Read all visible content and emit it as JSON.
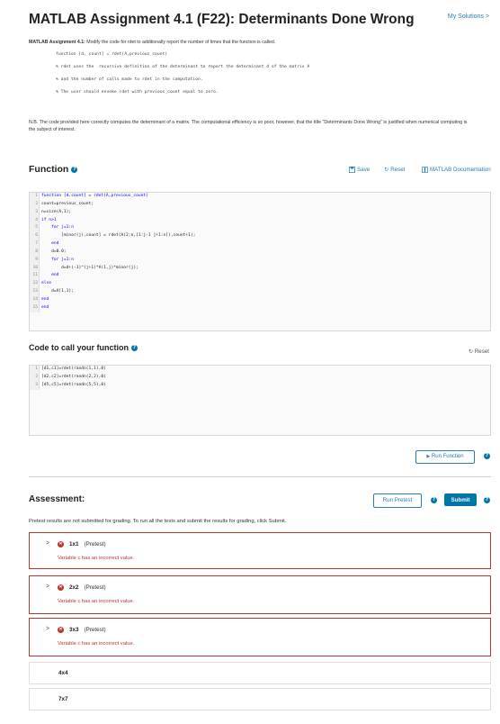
{
  "header": {
    "title": "MATLAB Assignment 4.1 (F22): Determinants Done Wrong",
    "my_solutions": "My Solutions >"
  },
  "intro": {
    "label": "MATLAB Assignment 4.1:",
    "text": "Modify the code for rdet to additionally report the number of times that the function is called.",
    "code_lines": [
      "function [d, count] = rdet(A,previous_count)",
      "% rdet uses the  recursive definition of the determinant to report the determinant d of the matrix A",
      "% and the number of calls made to rdet in the computation.",
      "% The user should envoke rdet with previous_count equal to zero."
    ]
  },
  "nb_text": "N.B. The code provided here correctly computes the determinant of a matrix.  The computational efficiency is so poor, however, that the title \"Determinants Done Wrong\" is justified when numerical computing is the subject of interest.",
  "function_section": {
    "heading": "Function",
    "help_glyph": "?",
    "save": "Save",
    "reset": "Reset",
    "doc": "MATLAB Documentation",
    "code": [
      "function [d,count] = rdet(A,previous_count)",
      "count=previous_count;",
      "n=size(A,1);",
      "if n>1",
      "    for j=1:n",
      "        [minor(j),count] = rdet(A(2:n,[1:j-1 j+1:n]),count+1);",
      "    end",
      "    d=0.0;",
      "    for j=1:n",
      "        d=d+(-1)^(j+1)*A(1,j)*minor(j);",
      "    end",
      "else",
      "    d=A(1,1);",
      "end",
      "end"
    ]
  },
  "call_section": {
    "heading": "Code to call your function",
    "reset": "Reset",
    "code": [
      "[d1,c1]=rdet(randn(1,1),0)",
      "[d2,c2]=rdet(randn(2,2),0)",
      "[d5,c5]=rdet(randn(5,5),0)"
    ],
    "run_button": "Run Function"
  },
  "assessment": {
    "heading": "Assessment:",
    "run_pretest": "Run Pretest",
    "submit": "Submit",
    "note": "Pretest results are not submitted for grading. To run all the tests and submit the results for grading, click Submit.",
    "tests": [
      {
        "name": "1x1",
        "mode": "(Pretest)",
        "message": "Variable c has an incorrect value."
      },
      {
        "name": "2x2",
        "mode": "(Pretest)",
        "message": "Variable c has an incorrect value."
      },
      {
        "name": "3x3",
        "mode": "(Pretest)",
        "message": "Variable c has an incorrect value."
      }
    ],
    "pending": [
      "4x4",
      "7x7"
    ]
  },
  "colors": {
    "accent": "#0076a8",
    "link": "#2a7bb7",
    "fail": "#c0342c",
    "keyword": "#0000ff",
    "comment": "#228b22"
  }
}
